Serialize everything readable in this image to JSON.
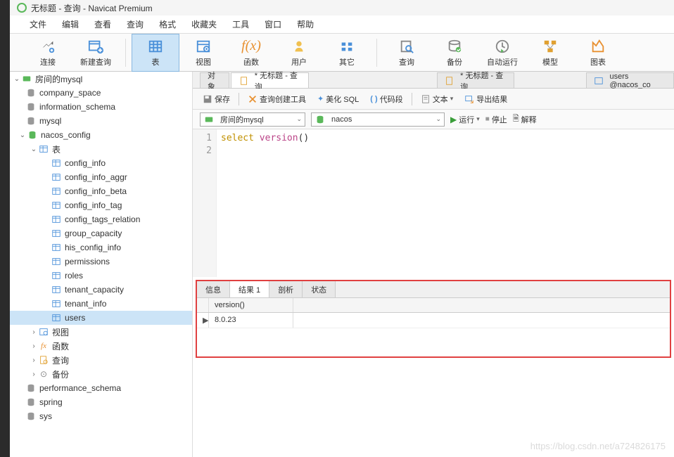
{
  "title": "无标题 - 查询 - Navicat Premium",
  "menu": [
    "文件",
    "编辑",
    "查看",
    "查询",
    "格式",
    "收藏夹",
    "工具",
    "窗口",
    "帮助"
  ],
  "toolbar": [
    {
      "label": "连接"
    },
    {
      "label": "新建查询"
    },
    {
      "label": "表",
      "active": true
    },
    {
      "label": "视图"
    },
    {
      "label": "函数"
    },
    {
      "label": "用户"
    },
    {
      "label": "其它"
    },
    {
      "label": "查询"
    },
    {
      "label": "备份"
    },
    {
      "label": "自动运行"
    },
    {
      "label": "模型"
    },
    {
      "label": "图表"
    }
  ],
  "tree": {
    "conn": "房间的mysql",
    "dbs": [
      {
        "name": "company_space",
        "open": false
      },
      {
        "name": "information_schema",
        "open": false
      },
      {
        "name": "mysql",
        "open": false
      },
      {
        "name": "nacos_config",
        "open": true,
        "tables_label": "表",
        "tables": [
          "config_info",
          "config_info_aggr",
          "config_info_beta",
          "config_info_tag",
          "config_tags_relation",
          "group_capacity",
          "his_config_info",
          "permissions",
          "roles",
          "tenant_capacity",
          "tenant_info",
          "users"
        ],
        "other": [
          {
            "label": "视图",
            "type": "view"
          },
          {
            "label": "函数",
            "type": "fx"
          },
          {
            "label": "查询",
            "type": "query"
          },
          {
            "label": "备份",
            "type": "backup"
          }
        ]
      },
      {
        "name": "performance_schema",
        "open": false
      },
      {
        "name": "spring",
        "open": false
      },
      {
        "name": "sys",
        "open": false
      }
    ]
  },
  "tabs": [
    {
      "label": "对象",
      "active": false
    },
    {
      "label": "* 无标题 - 查询",
      "active": true,
      "star": true
    },
    {
      "label": "* 无标题 - 查询",
      "active": false,
      "star": true
    },
    {
      "label": "users @nacos_co",
      "active": false,
      "table": true
    }
  ],
  "query_toolbar": {
    "save": "保存",
    "builder": "查询创建工具",
    "beautify": "美化 SQL",
    "snippet": "代码段",
    "text": "文本",
    "export": "导出结果"
  },
  "conn_row": {
    "connection": "房间的mysql",
    "database": "nacos",
    "run": "运行",
    "stop": "停止",
    "explain": "解释"
  },
  "editor": {
    "lines": [
      "select version()",
      ""
    ]
  },
  "result_tabs": [
    "信息",
    "结果 1",
    "剖析",
    "状态"
  ],
  "result_active": 1,
  "result": {
    "header": "version()",
    "rows": [
      "8.0.23"
    ]
  },
  "watermark": "https://blog.csdn.net/a724826175"
}
